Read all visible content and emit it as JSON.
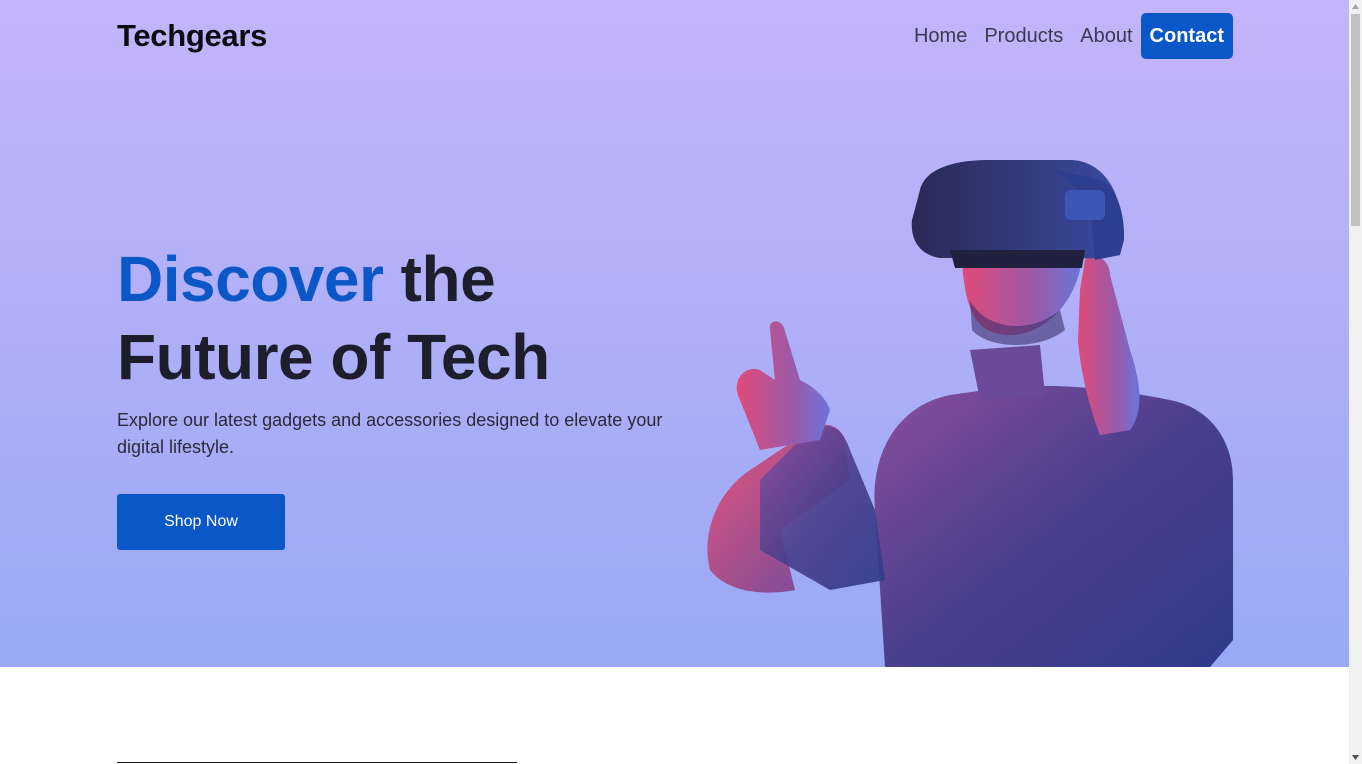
{
  "brand": {
    "logo_text": "Techgears"
  },
  "nav": {
    "items": [
      "Home",
      "Products",
      "About"
    ],
    "contact_label": "Contact"
  },
  "hero": {
    "headline_accent": "Discover",
    "headline_rest_line1": " the",
    "headline_line2": "Future of Tech",
    "subtext": "Explore our latest gadgets and accessories designed to elevate your digital lifestyle.",
    "cta_label": "Shop Now",
    "image_subject": "man wearing VR headset pointing forward"
  },
  "colors": {
    "accent": "#0a57c8",
    "hero_gradient_top": "#c4b4fb",
    "hero_gradient_bottom": "#99a9f6",
    "heading_text": "#1d1d2b"
  }
}
